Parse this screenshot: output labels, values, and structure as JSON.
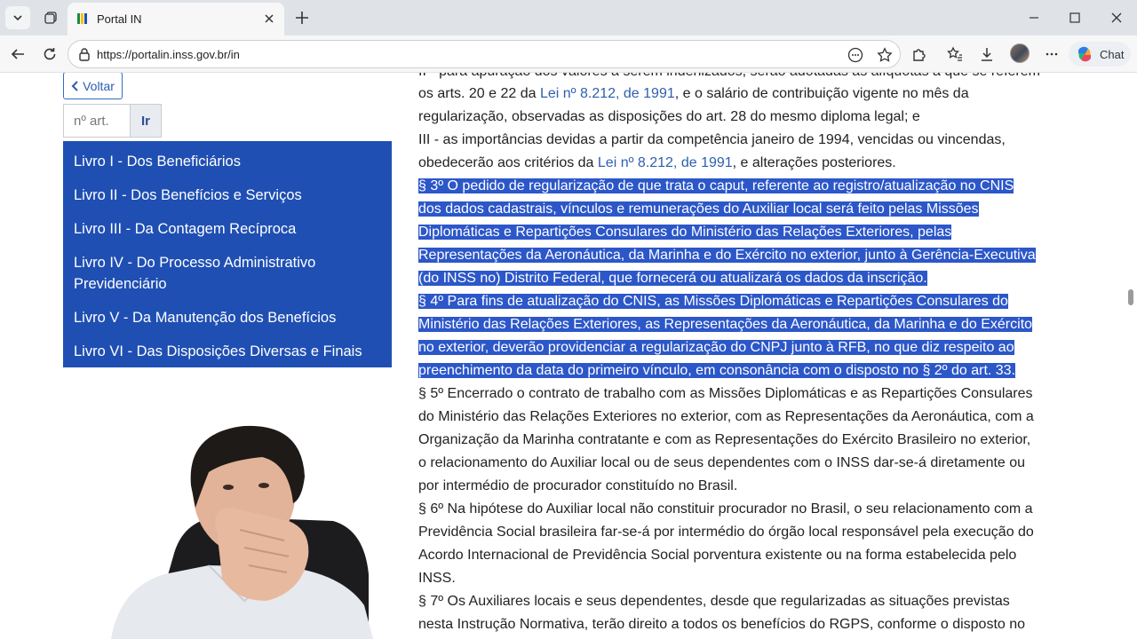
{
  "browser": {
    "tab_title": "Portal IN",
    "url": "https://portalin.inss.gov.br/in",
    "chat_label": "Chat"
  },
  "nav": {
    "back_label": "Voltar",
    "article_placeholder": "nº art.",
    "go_label": "Ir",
    "books": [
      "Livro I - Dos Beneficiários",
      "Livro II - Dos Benefícios e Serviços",
      "Livro III - Da Contagem Recíproca",
      "Livro IV - Do Processo Administrativo Previdenciário",
      "Livro V - Da Manutenção dos Benefícios",
      "Livro VI - Das Disposições Diversas e Finais"
    ]
  },
  "content": {
    "l0": "II - para apuração dos valores a serem indenizados, serão adotadas as alíquotas a que se referem",
    "l1a": "os arts. 20 e 22 da ",
    "l1link": "Lei nº 8.212, de 1991",
    "l1b": ", e o salário de contribuição vigente no mês da",
    "l2": "regularização, observadas as disposições do art. 28 do mesmo diploma legal; e",
    "l3": "III - as importâncias devidas a partir da competência janeiro de 1994, vencidas ou vincendas,",
    "l4a": "obedecerão aos critérios da ",
    "l4link": "Lei nº 8.212, de 1991",
    "l4b": ", e alterações posteriores.",
    "s3_1": "§ 3º O pedido de regularização de que trata o caput, referente ao registro/atualização no CNIS",
    "s3_2": "dos dados cadastrais, vínculos e remunerações do Auxiliar local será feito pelas Missões",
    "s3_3": "Diplomáticas e Repartições Consulares do Ministério das Relações Exteriores, pelas",
    "s3_4": "Representações da Aeronáutica, da Marinha e do Exército no exterior, junto à Gerência-Executiva",
    "s3_5": "(do INSS no) Distrito Federal, que fornecerá ou atualizará os dados da inscrição.",
    "s4_1": "§ 4º Para fins de atualização do CNIS, as Missões Diplomáticas e Repartições Consulares do",
    "s4_2": "Ministério das Relações Exteriores, as Representações da Aeronáutica, da Marinha e do Exército",
    "s4_3": "no exterior, deverão providenciar a regularização do CNPJ junto à RFB, no que diz respeito ao",
    "s4_4": "preenchimento da data do primeiro vínculo, em consonância com o disposto no § 2º do art. 33.",
    "s5_1": "§ 5º Encerrado o contrato de trabalho com as Missões Diplomáticas e as Repartições Consulares",
    "s5_2": "do Ministério das Relações Exteriores no exterior, com as Representações da Aeronáutica, com a",
    "s5_3": "Organização da Marinha contratante e com as Representações do Exército Brasileiro no exterior,",
    "s5_4": "o relacionamento do Auxiliar local ou de seus dependentes com o INSS dar-se-á diretamente ou",
    "s5_5": "por intermédio de procurador constituído no Brasil.",
    "s6_1": "§ 6º Na hipótese do Auxiliar local não constituir procurador no Brasil, o seu relacionamento com a",
    "s6_2": "Previdência Social brasileira far-se-á por intermédio do órgão local responsável pela execução do",
    "s6_3": "Acordo Internacional de Previdência Social porventura existente ou na forma estabelecida pelo",
    "s6_4": "INSS.",
    "s7_1": "§ 7º Os Auxiliares locais e seus dependentes, desde que regularizadas as situações previstas",
    "s7_2": "nesta Instrução Normativa, terão direito a todos os benefícios do RGPS, conforme o disposto no"
  },
  "colors": {
    "menu_bg": "#1f4fb3",
    "selection_bg": "#2c57c9",
    "link": "#2e5fae"
  }
}
